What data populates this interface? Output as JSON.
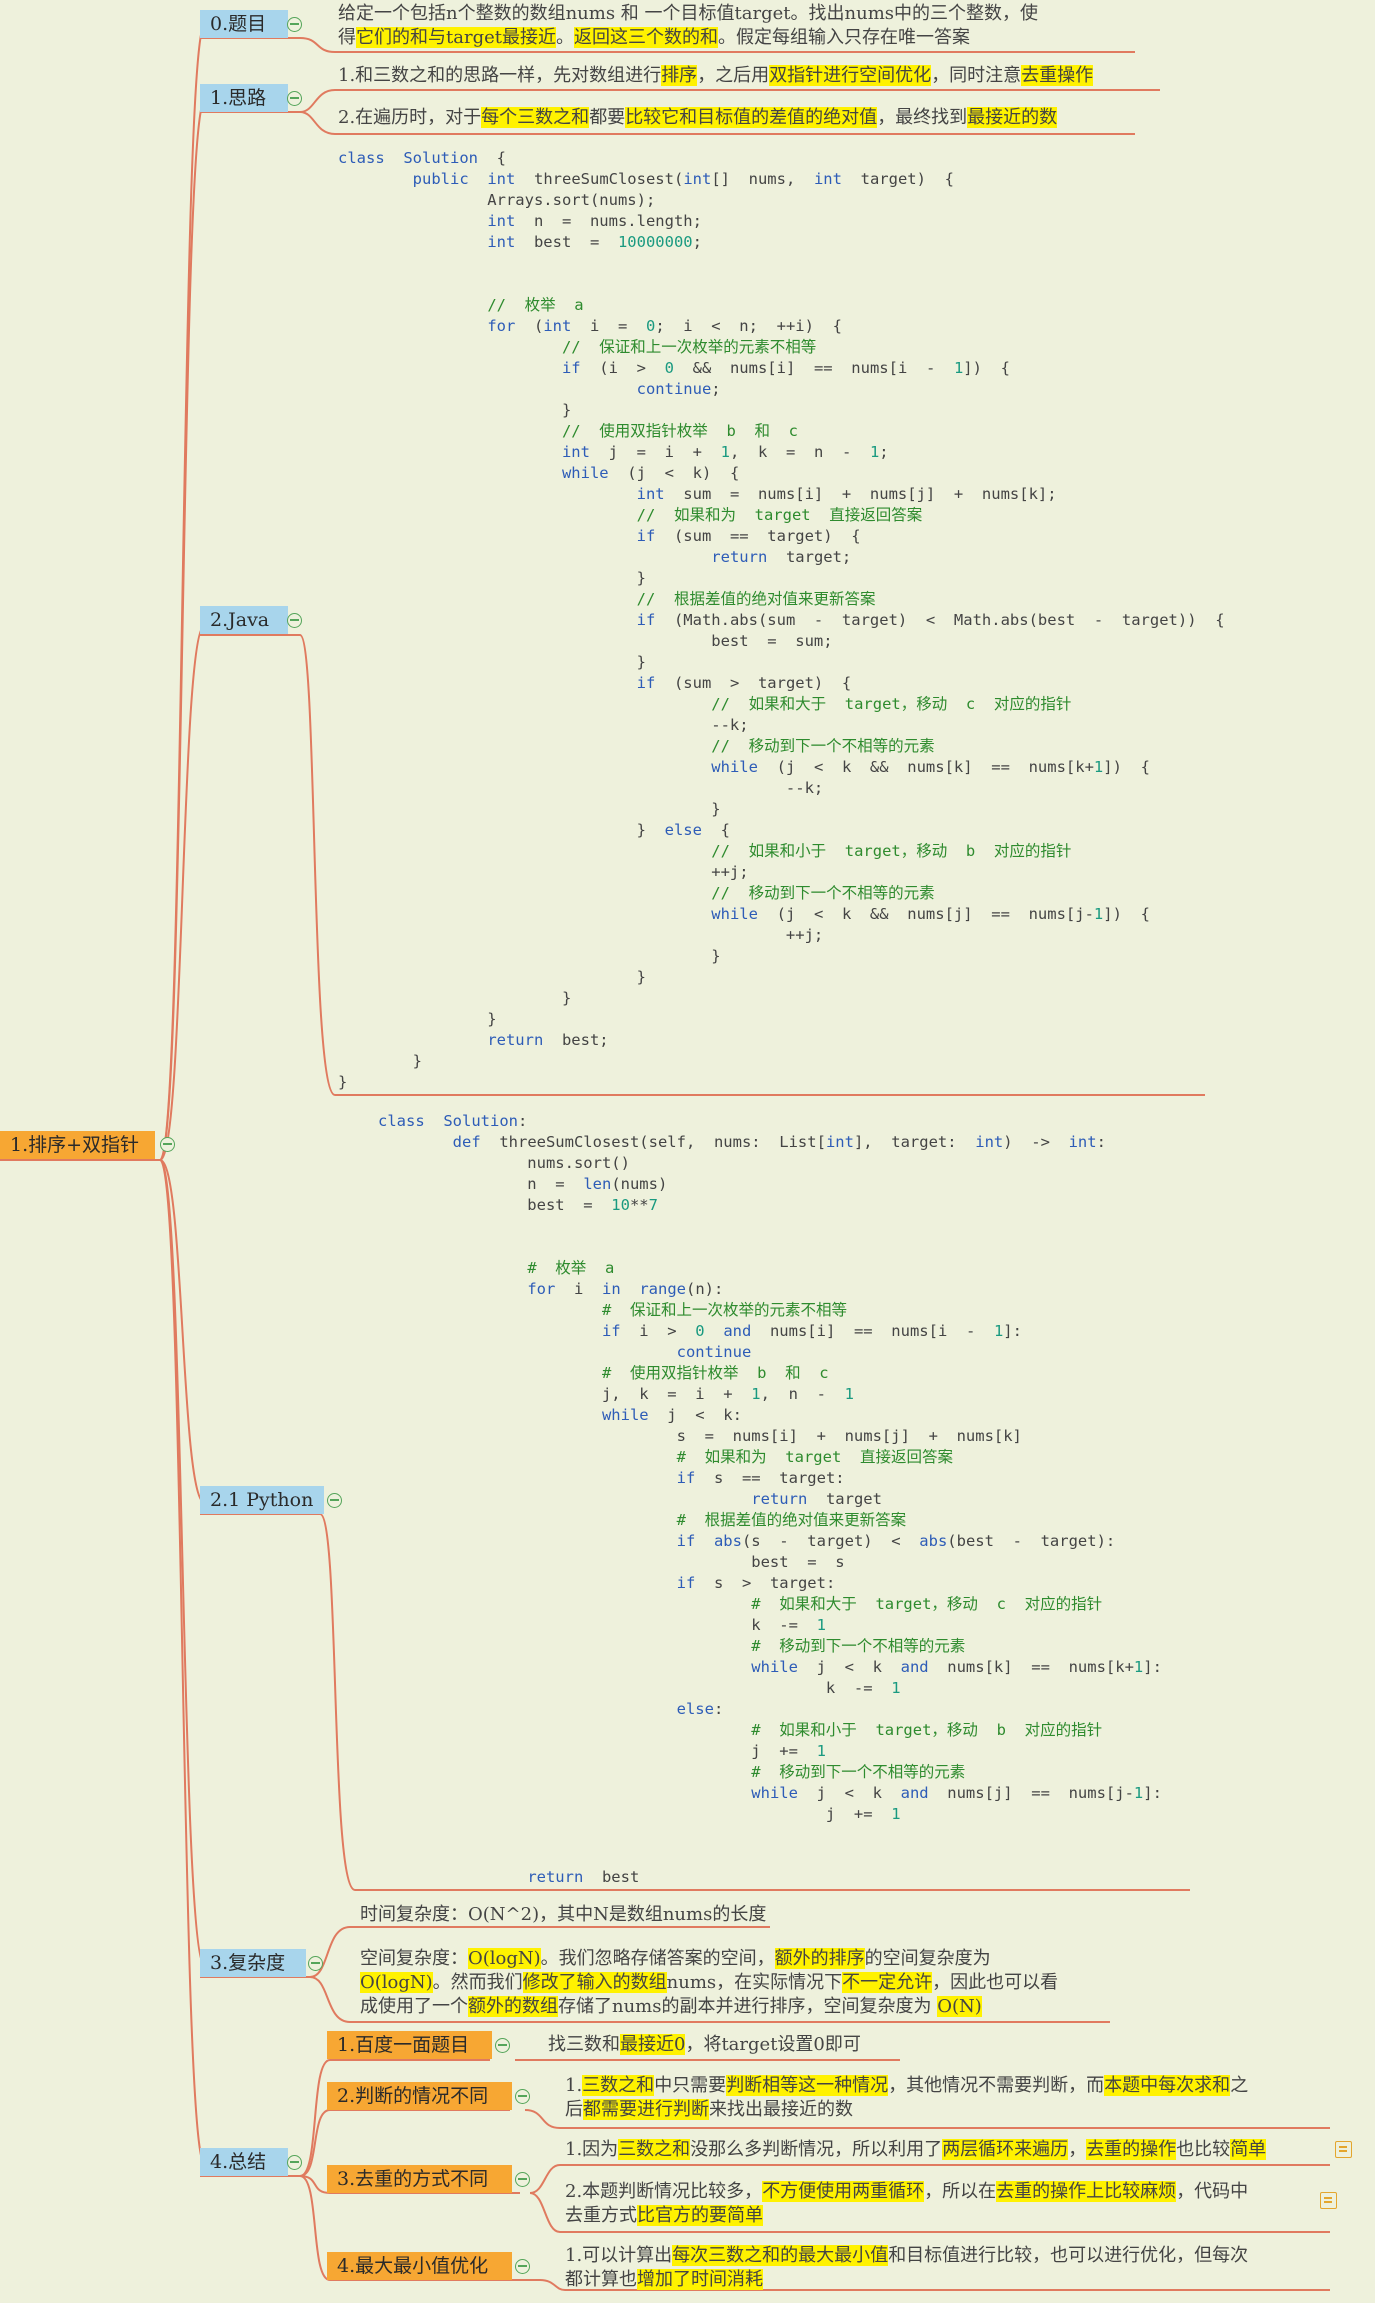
{
  "root": "1.排序+双指针",
  "topics": {
    "t0": "0.题目",
    "t1": "1.思路",
    "t2": "2.Java",
    "t21": "2.1 Python",
    "t3": "3.复杂度",
    "t4": "4.总结"
  },
  "problem": {
    "l1": "给定一个包括n个整数的数组nums 和 一个目标值target。找出nums中的三个整数，使",
    "l2a": "得",
    "l2b": "它们的和与target最接近",
    "l2c": "。",
    "l2d": "返回这三个数的和",
    "l2e": "。假定每组输入只存在唯一答案"
  },
  "idea": {
    "i1a": "1.和三数之和的思路一样，先对数组进行",
    "i1b": "排序",
    "i1c": "，之后用",
    "i1d": "双指针进行空间优化",
    "i1e": "，同时注意",
    "i1f": "去重操作",
    "i2a": "2.在遍历时，对于",
    "i2b": "每个三数之和",
    "i2c": "都要",
    "i2d": "比较它和目标值的差值的绝对值",
    "i2e": "，最终找到",
    "i2f": "最接近的数"
  },
  "java": [
    "class  Solution  {",
    "        public  int  threeSumClosest(int[]  nums,  int  target)  {",
    "                Arrays.sort(nums);",
    "                int  n  =  nums.length;",
    "                int  best  =  10000000;",
    "",
    "",
    "                //  枚举  a",
    "                for  (int  i  =  0;  i  <  n;  ++i)  {",
    "                        //  保证和上一次枚举的元素不相等",
    "                        if  (i  >  0  &&  nums[i]  ==  nums[i  -  1])  {",
    "                                continue;",
    "                        }",
    "                        //  使用双指针枚举  b  和  c",
    "                        int  j  =  i  +  1,  k  =  n  -  1;",
    "                        while  (j  <  k)  {",
    "                                int  sum  =  nums[i]  +  nums[j]  +  nums[k];",
    "                                //  如果和为  target  直接返回答案",
    "                                if  (sum  ==  target)  {",
    "                                        return  target;",
    "                                }",
    "                                //  根据差值的绝对值来更新答案",
    "                                if  (Math.abs(sum  -  target)  <  Math.abs(best  -  target))  {",
    "                                        best  =  sum;",
    "                                }",
    "                                if  (sum  >  target)  {",
    "                                        //  如果和大于  target，移动  c  对应的指针",
    "                                        --k;",
    "                                        //  移动到下一个不相等的元素",
    "                                        while  (j  <  k  &&  nums[k]  ==  nums[k+1])  {",
    "                                                --k;",
    "                                        }",
    "                                }  else  {",
    "                                        //  如果和小于  target，移动  b  对应的指针",
    "                                        ++j;",
    "                                        //  移动到下一个不相等的元素",
    "                                        while  (j  <  k  &&  nums[j]  ==  nums[j-1])  {",
    "                                                ++j;",
    "                                        }",
    "                                }",
    "                        }",
    "                }",
    "                return  best;",
    "        }",
    "}"
  ],
  "python": [
    "class  Solution:",
    "        def  threeSumClosest(self,  nums:  List[int],  target:  int)  ->  int:",
    "                nums.sort()",
    "                n  =  len(nums)",
    "                best  =  10**7",
    "",
    "",
    "                #  枚举  a",
    "                for  i  in  range(n):",
    "                        #  保证和上一次枚举的元素不相等",
    "                        if  i  >  0  and  nums[i]  ==  nums[i  -  1]:",
    "                                continue",
    "                        #  使用双指针枚举  b  和  c",
    "                        j,  k  =  i  +  1,  n  -  1",
    "                        while  j  <  k:",
    "                                s  =  nums[i]  +  nums[j]  +  nums[k]",
    "                                #  如果和为  target  直接返回答案",
    "                                if  s  ==  target:",
    "                                        return  target",
    "                                #  根据差值的绝对值来更新答案",
    "                                if  abs(s  -  target)  <  abs(best  -  target):",
    "                                        best  =  s",
    "                                if  s  >  target:",
    "                                        #  如果和大于  target，移动  c  对应的指针",
    "                                        k  -=  1",
    "                                        #  移动到下一个不相等的元素",
    "                                        while  j  <  k  and  nums[k]  ==  nums[k+1]:",
    "                                                k  -=  1",
    "                                else:",
    "                                        #  如果和小于  target，移动  b  对应的指针",
    "                                        j  +=  1",
    "                                        #  移动到下一个不相等的元素",
    "                                        while  j  <  k  and  nums[j]  ==  nums[j-1]:",
    "                                                j  +=  1",
    "",
    "",
    "                return  best"
  ],
  "complexity": {
    "time": "时间复杂度：O(N^2)，其中N是数组nums的长度",
    "s1a": "空间复杂度：",
    "s1b": "O(logN)",
    "s1c": "。我们忽略存储答案的空间，",
    "s1d": "额外的排序",
    "s1e": "的空间复杂度为",
    "s2a": "O(logN)",
    "s2b": "。然而我们",
    "s2c": "修改了输入的数组",
    "s2d": "nums，在实际情况下",
    "s2e": "不一定允许",
    "s2f": "，因此也可以看",
    "s3a": "成使用了一个",
    "s3b": "额外的数组",
    "s3c": "存储了nums的副本并进行排序，空间复杂度为 ",
    "s3d": "O(N)"
  },
  "summary": {
    "n1": "1.百度一面题目",
    "n1t_a": "找三数和",
    "n1t_b": "最接近0",
    "n1t_c": "，将target设置0即可",
    "n2": "2.判断的情况不同",
    "n2t1a": "1.",
    "n2t1b": "三数之和",
    "n2t1c": "中只需要",
    "n2t1d": "判断相等这一种情况",
    "n2t1e": "，其他情况不需要判断，而",
    "n2t1f": "本题中每次求和",
    "n2t1g": "之",
    "n2t2a": "后",
    "n2t2b": "都需要进行判断",
    "n2t2c": "来找出最接近的数",
    "n3": "3.去重的方式不同",
    "n3t1a": "1.因为",
    "n3t1b": "三数之和",
    "n3t1c": "没那么多判断情况，所以利用了",
    "n3t1d": "两层循环来遍历",
    "n3t1e": "，",
    "n3t1f": "去重的操作",
    "n3t1g": "也比较",
    "n3t1h": "简单",
    "n3t2a": "2.本题判断情况比较多，",
    "n3t2b": "不方便使用两重循环",
    "n3t2c": "，所以在",
    "n3t2d": "去重的操作上比较麻烦",
    "n3t2e": "，代码中",
    "n3t3a": "去重方式",
    "n3t3b": "比官方的要简单",
    "n4": "4.最大最小值优化",
    "n4t1a": "1.可以计算出",
    "n4t1b": "每次三数之和的最大最小值",
    "n4t1c": "和目标值进行比较，也可以进行优化，但每次",
    "n4t2a": "都计算也",
    "n4t2b": "增加了时间消耗"
  },
  "colors": {
    "background": "#eef1dc",
    "link": "#e07a5f",
    "blue_node": "#a8d5ec",
    "orange_node": "#f7a733",
    "highlight": "#fff200"
  }
}
